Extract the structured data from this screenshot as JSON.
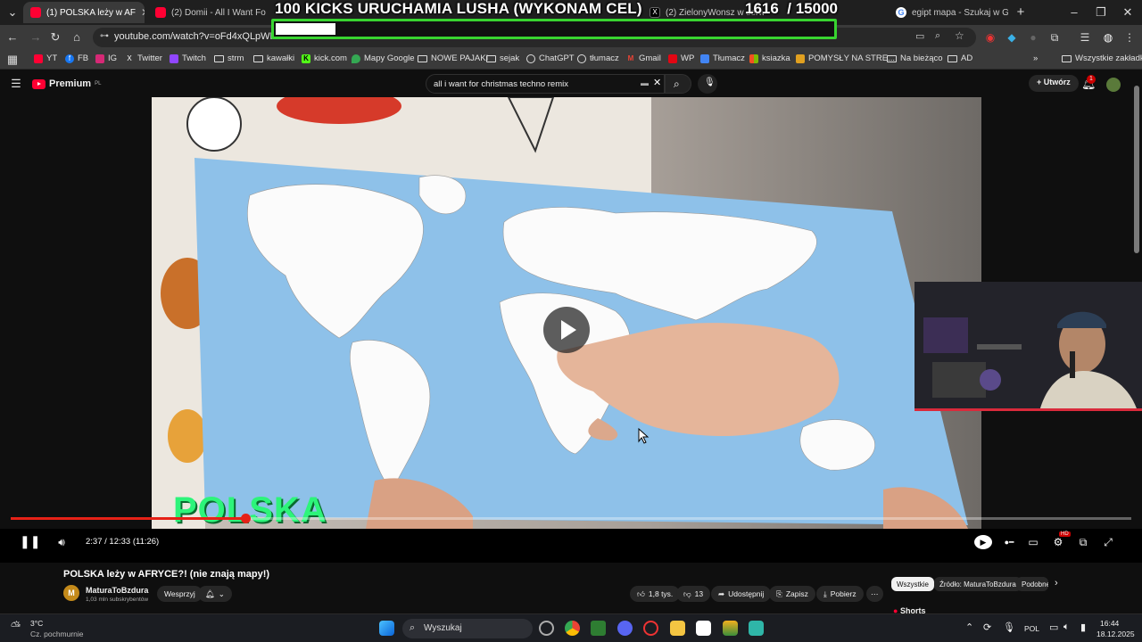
{
  "browser": {
    "tabs": [
      {
        "label": "(1) POLSKA leży w AF",
        "icon": "youtube-icon",
        "active": true
      },
      {
        "label": "(2) Domii - All I Want For",
        "icon": "youtube-icon",
        "active": false
      },
      {
        "label": "(2) ZielonyWonsz w serw",
        "icon": "x-icon",
        "active": false
      },
      {
        "label": "egipt mapa - Szukaj w G",
        "icon": "google-icon",
        "active": false
      }
    ],
    "new_tab": "+",
    "url": "youtube.com/watch?v=oFd4xQLpWFc"
  },
  "overlay": {
    "title": "100 KICKS URUCHAMIA LUSHA (WYKONAM CEL)",
    "current": "1616",
    "goal": "/ 15000",
    "progress": 0.108
  },
  "bookmarks": {
    "items": [
      {
        "label": "YT",
        "icon": "youtube-icon"
      },
      {
        "label": "FB",
        "icon": "facebook-icon"
      },
      {
        "label": "IG",
        "icon": "instagram-icon"
      },
      {
        "label": "Twitter",
        "icon": "x-icon"
      },
      {
        "label": "Twitch",
        "icon": "twitch-icon"
      },
      {
        "label": "strm",
        "icon": "folder-icon"
      },
      {
        "label": "kawałki",
        "icon": "folder-icon"
      },
      {
        "label": "kick.com",
        "icon": "kick-icon"
      },
      {
        "label": "Mapy Google",
        "icon": "maps-icon"
      },
      {
        "label": "NOWE PAJAKI",
        "icon": "folder-icon"
      },
      {
        "label": "sejak",
        "icon": "folder-icon"
      },
      {
        "label": "ChatGPT",
        "icon": "chatgpt-icon"
      },
      {
        "label": "tłumacz",
        "icon": "chatgpt-icon"
      },
      {
        "label": "Gmail",
        "icon": "gmail-icon"
      },
      {
        "label": "WP",
        "icon": "wp-icon"
      },
      {
        "label": "Tłumacz",
        "icon": "translate-icon"
      },
      {
        "label": "ksiazka",
        "icon": "microsoft-icon"
      },
      {
        "label": "POMYSŁY NA STRE...",
        "icon": "folder-icon"
      },
      {
        "label": "Na bieżąco",
        "icon": "folder-icon"
      },
      {
        "label": "AD",
        "icon": "folder-icon"
      }
    ],
    "more": "»",
    "all_bookmarks": "Wszystkie zakładki"
  },
  "youtube": {
    "logo": "Premium",
    "logo_region": "PL",
    "search_query": "all i want for christmas techno remix",
    "create_label": "Utwórz",
    "notifications_count": "1",
    "video": {
      "caption": "POLSKA",
      "time": "2:37 / 12:33 (11:26)",
      "progress": 0.209,
      "title": "POLSKA leży w AFRYCE?! (nie znają mapy!)"
    },
    "channel": {
      "avatar_letter": "M",
      "name": "MaturaToBzdura",
      "subscribers": "1,03 mln subskrybentów",
      "support_label": "Wesprzyj",
      "subscribe_icon": "bell-icon"
    },
    "actions": {
      "likes": "1,8 tys.",
      "dislikes": "13",
      "share": "Udostępnij",
      "save": "Zapisz",
      "download": "Pobierz"
    },
    "chips": [
      "Wszystkie",
      "Źródło: MaturaToBzdura",
      "Podobne"
    ],
    "shorts_label": "Shorts",
    "settings_badge": "HD"
  },
  "taskbar": {
    "weather_temp": "3°C",
    "weather_desc": "Cz. pochmurnie",
    "search_placeholder": "Wyszukaj",
    "language": "POL",
    "time": "16:44",
    "date": "18.12.2025"
  },
  "colors": {
    "youtube_red": "#ff0033",
    "overlay_green": "#38d430",
    "caption_green": "#2df47a",
    "progress_red": "#e62117"
  }
}
